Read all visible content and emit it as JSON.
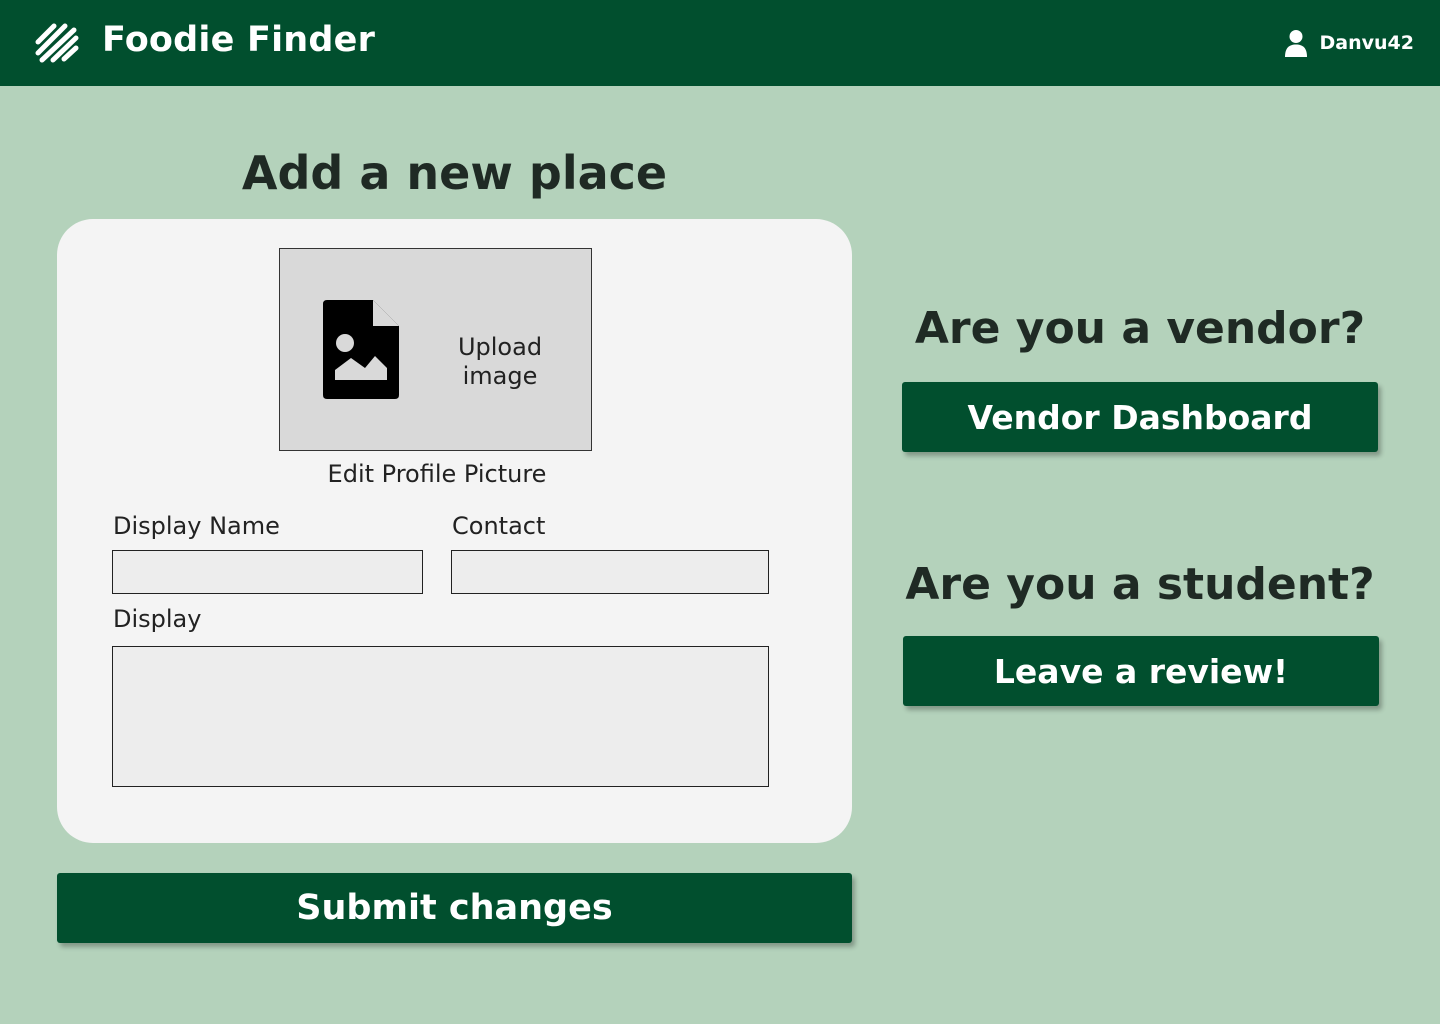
{
  "header": {
    "app_title": "Foodie Finder",
    "logo_icon": "striped-leaf-logo-icon",
    "user_icon": "person-icon",
    "username": "Danvu42"
  },
  "form": {
    "title": "Add a new place",
    "upload": {
      "icon": "image-file-icon",
      "label": "Upload image"
    },
    "edit_picture_label": "Edit Profile Picture",
    "display_name_label": "Display Name",
    "display_name_value": "",
    "contact_label": "Contact",
    "contact_value": "",
    "display_label": "Display",
    "display_value": "",
    "submit_label": "Submit changes"
  },
  "sidebar": {
    "vendor_heading": "Are you a vendor?",
    "vendor_button": "Vendor Dashboard",
    "student_heading": "Are you a student?",
    "student_button": "Leave a review!"
  },
  "colors": {
    "primary": "#014f2e",
    "background": "#b4d2bb",
    "card": "#f4f4f4"
  }
}
